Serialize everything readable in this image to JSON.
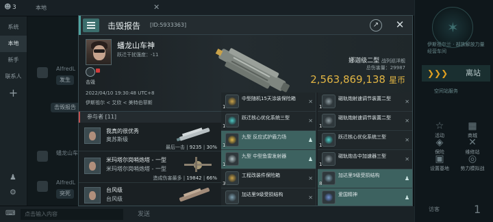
{
  "background": {
    "topbar": {
      "count": "3",
      "channel": "本地"
    },
    "nav": [
      {
        "label": "系统",
        "active": false
      },
      {
        "label": "本地",
        "active": true
      },
      {
        "label": "新手",
        "active": false
      },
      {
        "label": "联系人",
        "active": false
      }
    ],
    "chat": {
      "sender1": "AlfredL",
      "bubble1": "发生",
      "bubble2": "击毁报告",
      "sender2": "蟠龙山车",
      "sender3": "AlfredL",
      "bubble3": "突死"
    },
    "input_placeholder": "点击输入内容",
    "send_label": "发送",
    "right_panel": {
      "region": "伊斯祖尔兰 · 部族解放力量 经营车间",
      "station_label": "离站",
      "sub_label": "空间站服务",
      "cells": [
        {
          "icon": "activity-icon",
          "glyph": "☆",
          "label": "活动"
        },
        {
          "icon": "market-icon",
          "glyph": "▦",
          "label": "商城"
        },
        {
          "icon": "insurance-icon",
          "glyph": "◈",
          "label": "保险"
        },
        {
          "icon": "repair-icon",
          "glyph": "✕",
          "label": "维修站"
        },
        {
          "icon": "station-icon",
          "glyph": "▣",
          "label": "设置基地"
        },
        {
          "icon": "model-icon",
          "glyph": "◎",
          "label": "势力模拟战"
        }
      ],
      "footer_label": "访客",
      "footer_count": "1"
    }
  },
  "report": {
    "title": "击毁报告",
    "id_text": "[ID:5933363]",
    "victim": {
      "name": "蟠龙山车神",
      "interference": "跃迁干扰强度：-11",
      "tag": "击毁",
      "time": "2022/04/10 19:30:48 UTC+8",
      "location": "伊斯祖尔 < 艾欣 < 美特伯菲斯"
    },
    "ship": {
      "name": "娜迦级二型",
      "class": "战列巡洋舰",
      "damage_label": "总伤害量：",
      "damage": "29987",
      "isk": "2,563,869,138",
      "isk_unit": "星币",
      "result": "击毁"
    },
    "participants_header": "参与者 [11]",
    "participants": [
      {
        "name": "我真的很优秀",
        "corp": "奥苏斯级",
        "stat_label": "最后一击",
        "damage": "9235",
        "pct": "30%"
      },
      {
        "name": "米玛塔尔岗哨炮塔 - 一型",
        "corp": "米玛塔尔岗哨炮塔 - 一型",
        "stat_label": "造成伤害最多",
        "damage": "19842",
        "pct": "66%"
      },
      {
        "name": "台风级",
        "corp": "台风级",
        "stat_label": "",
        "damage": "",
        "pct": ""
      }
    ],
    "items": [
      {
        "qty": "1",
        "label": "中型随机15天涂装保险箱",
        "mark": "✕",
        "highlight": false,
        "color": "#c9a24a"
      },
      {
        "qty": "1",
        "label": "磁轨炮射速调节装置二型",
        "mark": "✕",
        "highlight": false,
        "color": "#8c9aa0"
      },
      {
        "qty": "1",
        "label": "跃迁核心优化系统三型",
        "mark": "✕",
        "highlight": false,
        "color": "#4fc8c4"
      },
      {
        "qty": "1",
        "label": "磁轨炮射速调节装置二型",
        "mark": "✕",
        "highlight": false,
        "color": "#8c9aa0"
      },
      {
        "qty": "1",
        "label": "九型 反应式护盾力场",
        "mark": "♟",
        "highlight": true,
        "color": "#e0b84a"
      },
      {
        "qty": "1",
        "label": "跃迁核心优化系统三型",
        "mark": "✕",
        "highlight": false,
        "color": "#4fc8c4"
      },
      {
        "qty": "1",
        "label": "九型 中型鱼雷发射器",
        "mark": "♟",
        "highlight": true,
        "color": "#b0c0c4"
      },
      {
        "qty": "1",
        "label": "磁轨炮击中加速器三型",
        "mark": "✕",
        "highlight": false,
        "color": "#8c9aa0"
      },
      {
        "qty": "3",
        "label": "工程改装件保险箱",
        "mark": "✕",
        "highlight": false,
        "color": "#c9a24a"
      },
      {
        "qty": "8",
        "label": "加达里9级受损结构",
        "mark": "♟",
        "highlight": true,
        "color": "#7fa0b0"
      },
      {
        "qty": "",
        "label": "加达里9级受损结构",
        "mark": "✕",
        "highlight": false,
        "color": "#7fa0b0"
      },
      {
        "qty": "",
        "label": "爱国精神",
        "mark": "♟",
        "highlight": true,
        "color": "#6f8fd0"
      }
    ]
  }
}
